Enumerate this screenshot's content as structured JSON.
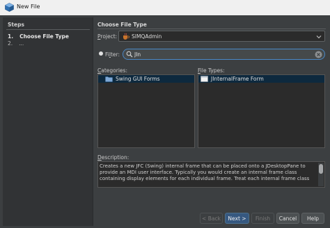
{
  "window": {
    "title": "New File"
  },
  "steps": {
    "heading": "Steps",
    "items": [
      {
        "num": "1.",
        "label": "Choose File Type"
      },
      {
        "num": "2.",
        "label": "..."
      }
    ]
  },
  "main": {
    "heading": "Choose File Type"
  },
  "project": {
    "label_mnemonic": "P",
    "label_rest": "roject:",
    "value": "SIMQAdmin"
  },
  "filter": {
    "label_pre": "Fi",
    "label_mnemonic": "l",
    "label_rest": "ter:",
    "value": "JIn"
  },
  "categories": {
    "label_mnemonic": "C",
    "label_rest": "ategories:",
    "items": [
      {
        "label": "Swing GUI Forms",
        "selected": true
      }
    ]
  },
  "file_types": {
    "label_mnemonic": "F",
    "label_rest": "ile Types:",
    "items": [
      {
        "label": "JInternalFrame Form",
        "selected": true
      }
    ]
  },
  "description": {
    "label_mnemonic": "D",
    "label_rest": "escription:",
    "text": "Creates a new JFC (Swing) internal frame that can be placed onto a JDesktopPane to\nprovide an MDI user interface. Typically you would create an internal frame class\ncontaining display elements for each individual frame. Treat each internal frame class"
  },
  "buttons": {
    "back": "< Back",
    "next": "Next >",
    "finish": "Finish",
    "cancel": "Cancel",
    "help": "Help"
  },
  "colors": {
    "accent": "#4a88c7",
    "selection": "#0d293e",
    "primary_button": "#365880"
  }
}
